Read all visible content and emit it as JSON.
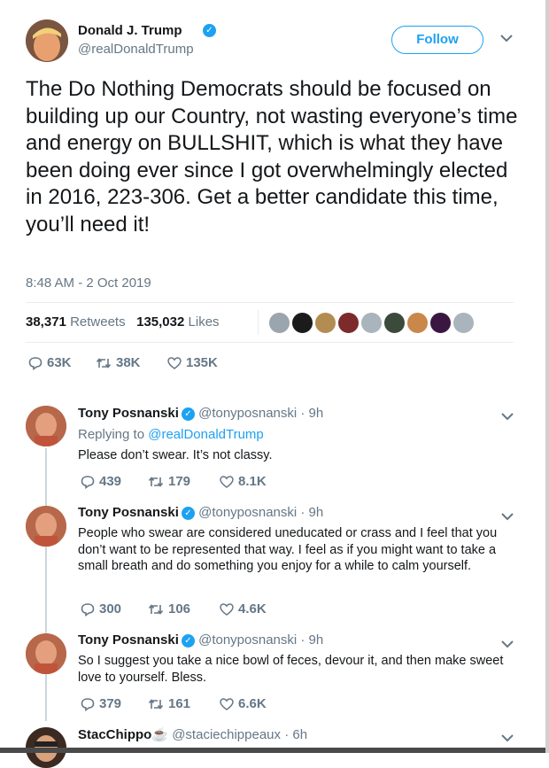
{
  "colors": {
    "accent": "#1da1f2",
    "muted": "#657786",
    "text": "#14171a",
    "line": "#ccd6dd"
  },
  "tweet": {
    "author_name": "Donald J. Trump",
    "author_handle": "@realDonaldTrump",
    "follow_label": "Follow",
    "text": "The Do Nothing Democrats should be focused on building up our Country, not wasting everyone’s time and energy on BULLSHIT, which is what they have been doing ever since I got overwhelmingly elected in 2016, 223-306. Get a better candidate this time, you’ll need it!",
    "timestamp": "8:48 AM - 2 Oct 2019",
    "retweets_count": "38,371",
    "retweets_label": "Retweets",
    "likes_count": "135,032",
    "likes_label": "Likes",
    "reply_count": "63K",
    "retweet_count_short": "38K",
    "like_count_short": "135K"
  },
  "replies": [
    {
      "name": "Tony Posnanski",
      "handle": "@tonyposnanski",
      "age": "· 9h",
      "replying_prefix": "Replying to ",
      "replying_to": "@realDonaldTrump",
      "text": "Please don’t swear. It’s not classy.",
      "replies": "439",
      "retweets": "179",
      "likes": "8.1K"
    },
    {
      "name": "Tony Posnanski",
      "handle": "@tonyposnanski",
      "age": "· 9h",
      "text": "People who swear are considered uneducated or crass and I feel that you don’t want to be represented that way. I feel as if you might want to take a small breath and do something you enjoy for a while to calm yourself.",
      "replies": "300",
      "retweets": "106",
      "likes": "4.6K"
    },
    {
      "name": "Tony Posnanski",
      "handle": "@tonyposnanski",
      "age": "· 9h",
      "text": "So I suggest you take a nice bowl of feces, devour it, and then make sweet love to yourself. Bless.",
      "replies": "379",
      "retweets": "161",
      "likes": "6.6K"
    },
    {
      "name": "StacChippo",
      "emoji": "☕",
      "handle": "@staciechippeaux",
      "age": "· 6h"
    }
  ]
}
